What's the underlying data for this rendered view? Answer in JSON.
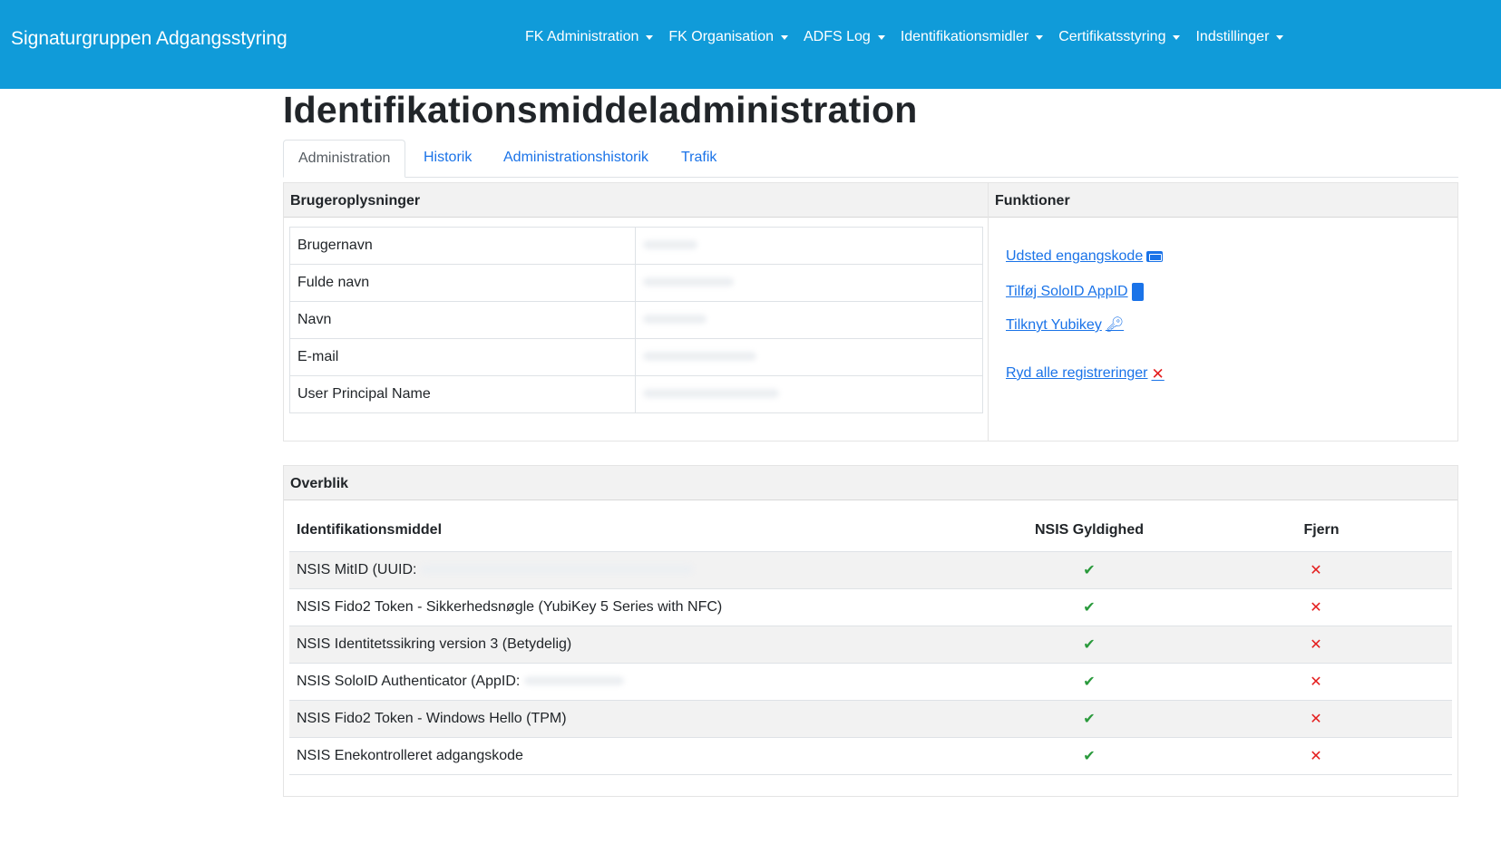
{
  "brand": "Signaturgruppen Adgangsstyring",
  "nav": [
    {
      "label": "FK Administration"
    },
    {
      "label": "FK Organisation"
    },
    {
      "label": "ADFS Log"
    },
    {
      "label": "Identifikationsmidler"
    },
    {
      "label": "Certifikatsstyring"
    },
    {
      "label": "Indstillinger"
    }
  ],
  "page_title": "Identifikationsmiddeladministration",
  "tabs": [
    "Administration",
    "Historik",
    "Administrationshistorik",
    "Trafik"
  ],
  "user_panel": {
    "title": "Brugeroplysninger",
    "fields": [
      "Brugernavn",
      "Fulde navn",
      "Navn",
      "E-mail",
      "User Principal Name"
    ]
  },
  "functions_panel": {
    "title": "Funktioner",
    "links": {
      "otp": "Udsted engangskode",
      "soloid": "Tilføj SoloID AppID",
      "yubikey": "Tilknyt Yubikey",
      "clear": "Ryd alle registreringer"
    }
  },
  "overview": {
    "title": "Overblik",
    "headers": [
      "Identifikationsmiddel",
      "NSIS Gyldighed",
      "Fjern"
    ],
    "rows": [
      "NSIS MitID (UUID:",
      "NSIS Fido2 Token - Sikkerhedsnøgle (YubiKey 5 Series with NFC)",
      "NSIS Identitetssikring version 3 (Betydelig)",
      "NSIS SoloID Authenticator (AppID:",
      "NSIS Fido2 Token - Windows Hello (TPM)",
      "NSIS Enekontrolleret adgangskode"
    ]
  },
  "colors": {
    "navbar": "#109bd9",
    "link": "#1a73e8",
    "check": "#2a9a3c",
    "remove": "#e41e1e"
  },
  "icons": {
    "otp": "ticket-icon",
    "soloid": "phone-icon",
    "yubikey": "key-icon",
    "clear": "x-icon",
    "valid": "check-icon",
    "remove": "x-icon"
  }
}
